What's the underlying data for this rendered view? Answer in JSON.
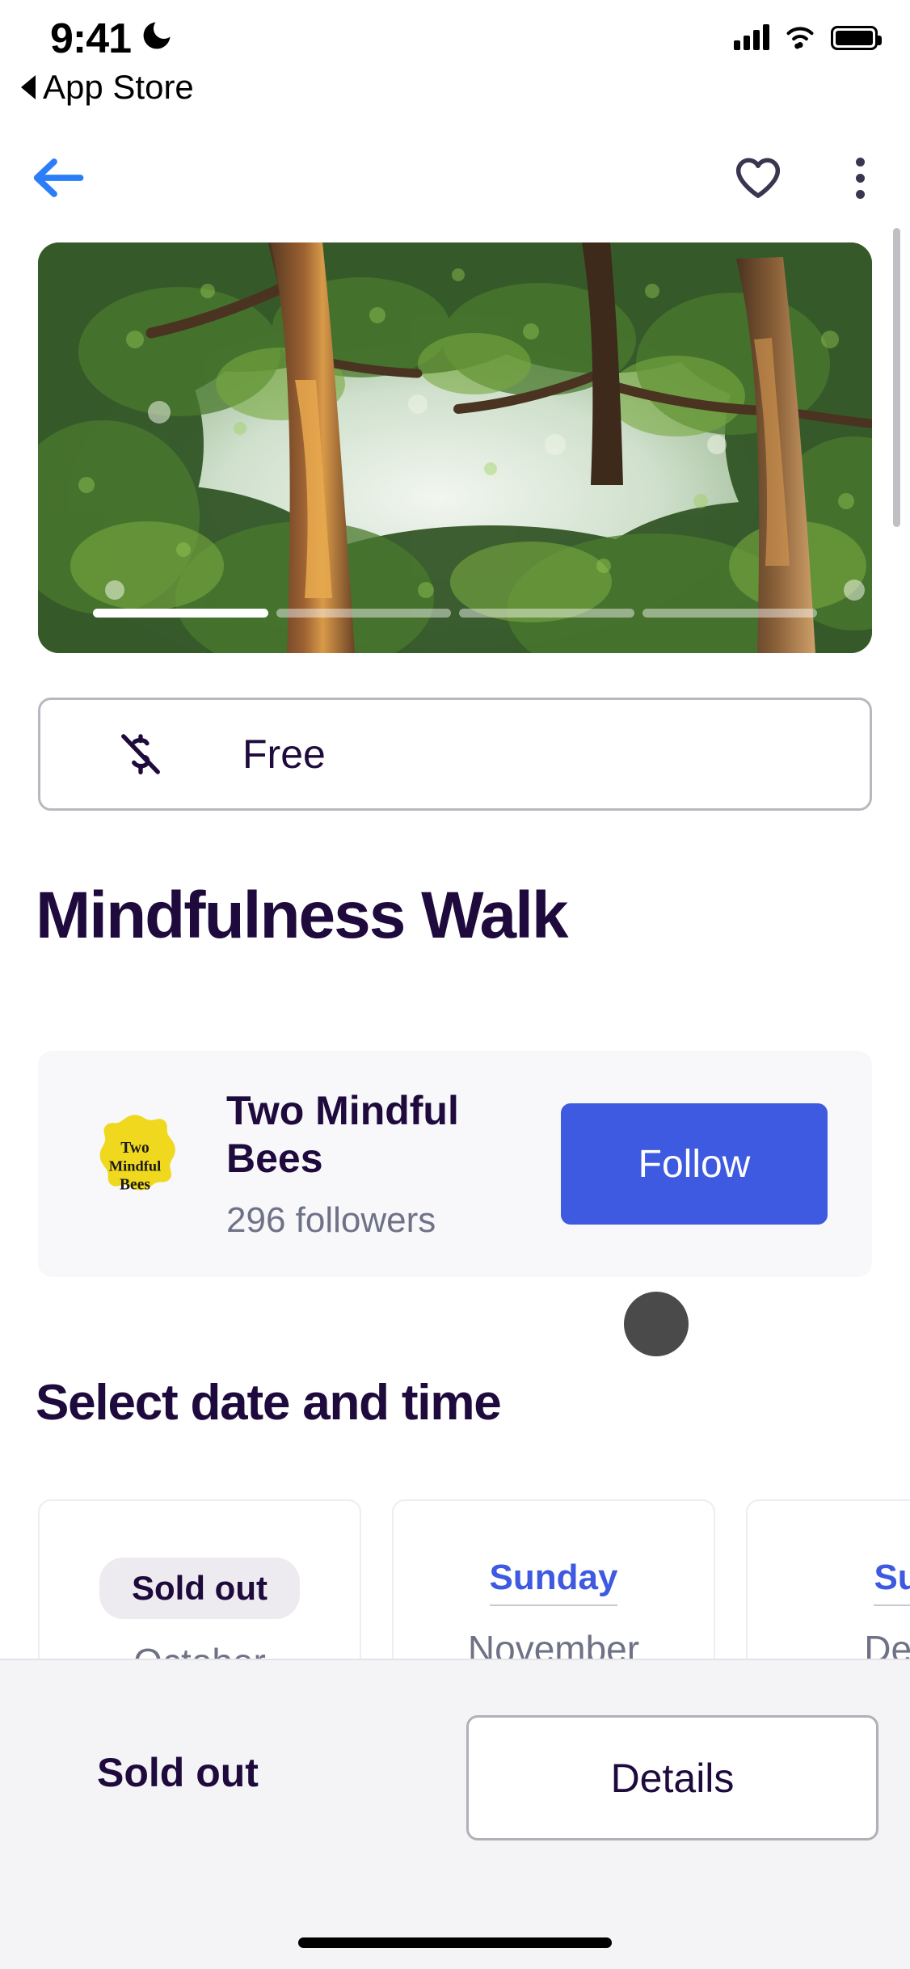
{
  "status_bar": {
    "time": "9:41",
    "dnd_icon": "moon-icon",
    "signal_icon": "cellular-signal-icon",
    "wifi_icon": "wifi-icon",
    "battery_icon": "battery-full-icon",
    "return_label": "App Store",
    "return_icon": "triangle-left-icon"
  },
  "navbar": {
    "back_icon": "arrow-left-icon",
    "favorite_icon": "heart-outline-icon",
    "overflow_icon": "kebab-menu-icon",
    "accent_color": "#2C7EF8"
  },
  "hero": {
    "image_alt": "tree-canopy-photo",
    "slide_count": 4,
    "active_slide": 1
  },
  "price_badge": {
    "icon": "money-off-icon",
    "label": "Free"
  },
  "event": {
    "title": "Mindfulness Walk"
  },
  "organizer": {
    "logo_line1": "Two",
    "logo_line2": "Mindful",
    "logo_line3": "Bees",
    "logo_color": "#EFD81D",
    "name": "Two Mindful Bees",
    "followers": "296 followers",
    "follow_label": "Follow",
    "follow_color": "#3D5AE0"
  },
  "section": {
    "heading": "Select date and time"
  },
  "date_cards": [
    {
      "badge": "Sold out",
      "day": "",
      "month": "October",
      "sold_out": true
    },
    {
      "badge": "",
      "day": "Sunday",
      "month": "November",
      "sold_out": false
    },
    {
      "badge": "",
      "day": "Sun",
      "month": "Dece",
      "sold_out": false
    }
  ],
  "bottom_bar": {
    "status": "Sold out",
    "details_label": "Details"
  }
}
